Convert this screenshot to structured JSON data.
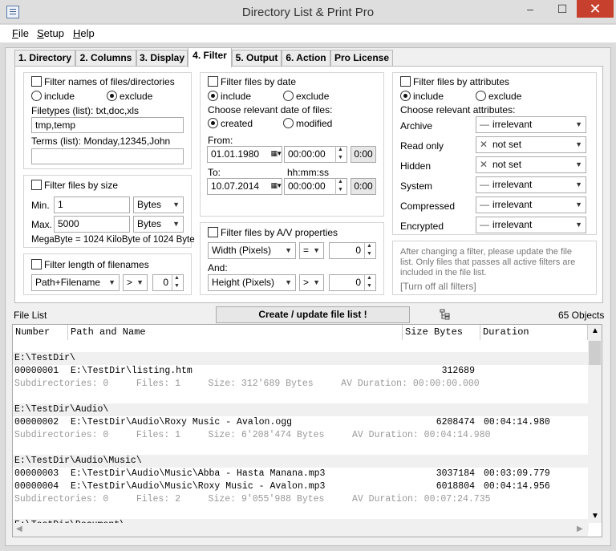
{
  "window": {
    "title": "Directory List & Print Pro",
    "min": "–",
    "max": "☐",
    "close": "✕"
  },
  "menu": [
    {
      "pre": "",
      "u": "F",
      "post": "ile"
    },
    {
      "pre": "",
      "u": "S",
      "post": "etup"
    },
    {
      "pre": "",
      "u": "H",
      "post": "elp"
    }
  ],
  "tabs": [
    "1. Directory",
    "2. Columns",
    "3. Display",
    "4. Filter",
    "5. Output",
    "6. Action",
    "Pro License"
  ],
  "names": {
    "title": "Filter names of files/directories",
    "include": "include",
    "exclude": "exclude",
    "types_label": "Filetypes (list): txt,doc,xls",
    "types_value": "tmp,temp",
    "terms_label": "Terms (list): Monday,12345,John",
    "terms_value": ""
  },
  "size": {
    "title": "Filter files by size",
    "min_label": "Min.",
    "min_value": "1",
    "min_unit": "Bytes",
    "max_label": "Max.",
    "max_value": "5000",
    "max_unit": "Bytes",
    "note": "MegaByte = 1024 KiloByte of 1024 Byte"
  },
  "length": {
    "title": "Filter length of filenames",
    "field": "Path+Filename",
    "op": ">",
    "value": "0"
  },
  "date": {
    "title": "Filter files by date",
    "include": "include",
    "exclude": "exclude",
    "choose": "Choose relevant date of files:",
    "created": "created",
    "modified": "modified",
    "from": "From:",
    "from_date": "01.01.1980",
    "from_time": "00:00:00",
    "from_btn": "0:00",
    "to": "To:",
    "hms": "hh:mm:ss",
    "to_date": "10.07.2014",
    "to_time": "00:00:00",
    "to_btn": "0:00"
  },
  "av": {
    "title": "Filter files by A/V properties",
    "p1": "Width (Pixels)",
    "op1": "=",
    "v1": "0",
    "and": "And:",
    "p2": "Height (Pixels)",
    "op2": ">",
    "v2": "0"
  },
  "attrs": {
    "title": "Filter files by attributes",
    "include": "include",
    "exclude": "exclude",
    "choose": "Choose relevant attributes:",
    "items": [
      {
        "name": "Archive",
        "icon": "—",
        "value": "irrelevant"
      },
      {
        "name": "Read only",
        "icon": "✕",
        "value": "not set"
      },
      {
        "name": "Hidden",
        "icon": "✕",
        "value": "not set"
      },
      {
        "name": "System",
        "icon": "—",
        "value": "irrelevant"
      },
      {
        "name": "Compressed",
        "icon": "—",
        "value": "irrelevant"
      },
      {
        "name": "Encrypted",
        "icon": "—",
        "value": "irrelevant"
      }
    ]
  },
  "note": {
    "l1": "After changing a filter, please update the file",
    "l2": "list. Only files that passes all active filters are",
    "l3": "included in the file list.",
    "link": "[Turn off all filters]"
  },
  "list": {
    "label": "File List",
    "create": "Create / update file list !",
    "objects": "65 Objects",
    "cols": [
      "Number",
      "Path and Name",
      "Size Bytes",
      "Duration"
    ],
    "rows": [
      {
        "t": "blank"
      },
      {
        "t": "dir",
        "path": "E:\\TestDir\\"
      },
      {
        "t": "file",
        "num": "00000001",
        "path": "E:\\TestDir\\listing.htm",
        "size": "312689",
        "dur": ""
      },
      {
        "t": "sub",
        "text": "Subdirectories: 0     Files: 1     Size: 312'689 Bytes     AV Duration: 00:00:00.000"
      },
      {
        "t": "blank"
      },
      {
        "t": "dir",
        "path": "E:\\TestDir\\Audio\\"
      },
      {
        "t": "file",
        "num": "00000002",
        "path": "E:\\TestDir\\Audio\\Roxy Music - Avalon.ogg",
        "size": "6208474",
        "dur": "00:04:14.980"
      },
      {
        "t": "sub",
        "text": "Subdirectories: 0     Files: 1     Size: 6'208'474 Bytes     AV Duration: 00:04:14.980"
      },
      {
        "t": "blank"
      },
      {
        "t": "dir",
        "path": "E:\\TestDir\\Audio\\Music\\"
      },
      {
        "t": "file",
        "num": "00000003",
        "path": "E:\\TestDir\\Audio\\Music\\Abba - Hasta Manana.mp3",
        "size": "3037184",
        "dur": "00:03:09.779"
      },
      {
        "t": "file",
        "num": "00000004",
        "path": "E:\\TestDir\\Audio\\Music\\Roxy Music - Avalon.mp3",
        "size": "6018804",
        "dur": "00:04:14.956"
      },
      {
        "t": "sub",
        "text": "Subdirectories: 0     Files: 2     Size: 9'055'988 Bytes     AV Duration: 00:07:24.735"
      },
      {
        "t": "blank"
      },
      {
        "t": "dir",
        "path": "E:\\TestDir\\Document\\"
      }
    ]
  }
}
